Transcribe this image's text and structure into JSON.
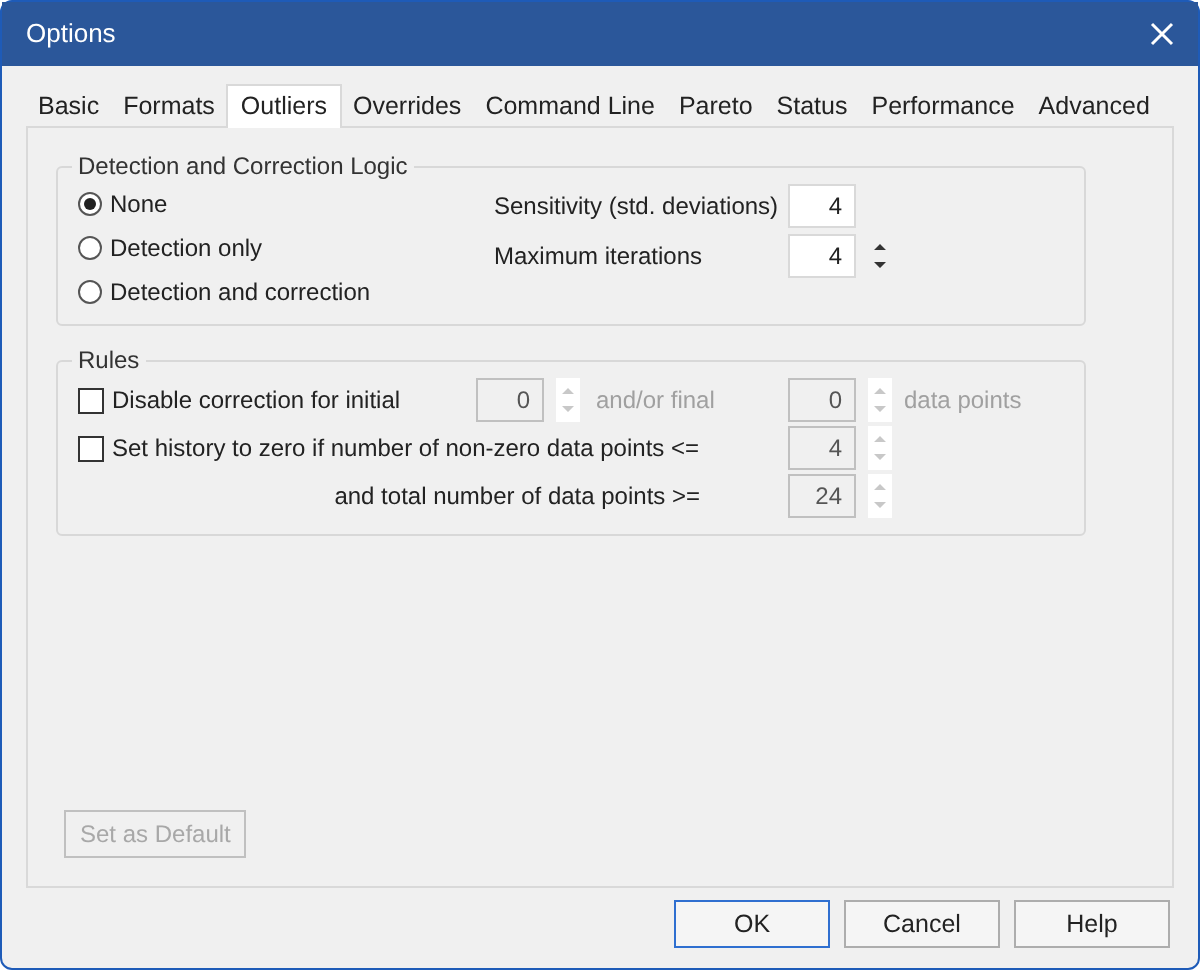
{
  "window": {
    "title": "Options"
  },
  "tabs": [
    {
      "label": "Basic",
      "selected": false
    },
    {
      "label": "Formats",
      "selected": false
    },
    {
      "label": "Outliers",
      "selected": true
    },
    {
      "label": "Overrides",
      "selected": false
    },
    {
      "label": "Command Line",
      "selected": false
    },
    {
      "label": "Pareto",
      "selected": false
    },
    {
      "label": "Status",
      "selected": false
    },
    {
      "label": "Performance",
      "selected": false
    },
    {
      "label": "Advanced",
      "selected": false
    }
  ],
  "detection": {
    "title": "Detection and Correction Logic",
    "radios": [
      {
        "label": "None",
        "selected": true
      },
      {
        "label": "Detection only",
        "selected": false
      },
      {
        "label": "Detection and correction",
        "selected": false
      }
    ],
    "fields": [
      {
        "label": "Sensitivity (std. deviations)",
        "value": "4",
        "spinner": false
      },
      {
        "label": "Maximum iterations",
        "value": "4",
        "spinner": true
      }
    ]
  },
  "rules": {
    "title": "Rules",
    "disable_correction": {
      "label": "Disable correction for initial",
      "checked": false,
      "initial": {
        "value": "0",
        "disabled": true
      },
      "connector": "and/or final",
      "final": {
        "value": "0",
        "disabled": true
      },
      "suffix": "data points",
      "suffix_disabled": true
    },
    "history_zero": {
      "label": "Set history to zero if number of non-zero data points <=",
      "checked": false,
      "field": {
        "value": "4",
        "disabled": true
      }
    },
    "total_points": {
      "label": "and total number of data points >=",
      "field": {
        "value": "24",
        "disabled": true
      }
    }
  },
  "set_default": {
    "label": "Set as Default",
    "disabled": true
  },
  "buttons": [
    {
      "label": "OK",
      "default": true
    },
    {
      "label": "Cancel",
      "default": false
    },
    {
      "label": "Help",
      "default": false
    }
  ]
}
